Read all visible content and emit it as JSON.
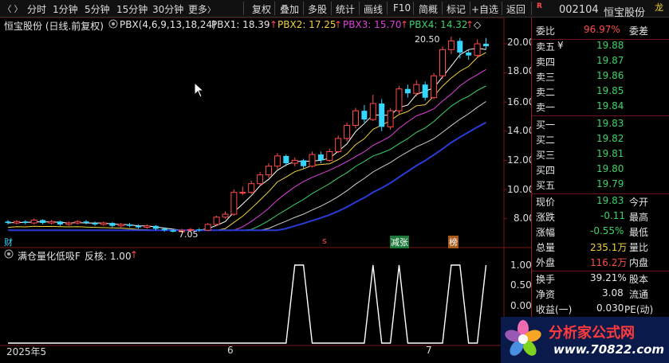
{
  "toolbar": {
    "periods": [
      "分时",
      "1分钟",
      "5分钟",
      "15分钟",
      "30分钟",
      "更多"
    ],
    "more_arrow": "〉",
    "actions": [
      "复权",
      "叠加",
      "多股",
      "统计",
      "画线",
      "F10",
      "简概",
      "标记",
      "+自选",
      "返回"
    ],
    "stock_code": "002104",
    "stock_name": "恒宝股份",
    "r_badge": "R",
    "dragon": "龙"
  },
  "chart_header": {
    "title": "恒宝股份 (日线.前复权)",
    "indicator": "PBX(4,6,9,13,18,24)",
    "pbx1": "PBX1: 18.39",
    "pbx2": "PBX2: 17.25",
    "pbx3": "PBX3: 15.70",
    "pbx4": "PBX4: 14.32",
    "up_arrow": "↑",
    "diamond": "◇"
  },
  "annotations": {
    "high_label": "20.50",
    "low_label": "7.05",
    "cai": "财",
    "s_mark": "s",
    "jian_zhang": "减张",
    "bang": "榜"
  },
  "price_axis": [
    "20.00",
    "18.00",
    "16.00",
    "14.00",
    "12.00",
    "10.00",
    "8.00"
  ],
  "sub_axis": [
    "1.00",
    "0.50",
    "0.00"
  ],
  "x_axis": [
    "2025年5",
    "6",
    "7"
  ],
  "sub_header": {
    "title": "满仓量化低吸F",
    "param": "反核: 1.00",
    "arrow": "↑"
  },
  "panel": {
    "wei_bi_label": "委比",
    "wei_bi_value": "96.97%",
    "wei_cha_label": "委差",
    "sells": [
      {
        "label": "卖五",
        "mark": "¥",
        "price": "19.88"
      },
      {
        "label": "卖四",
        "mark": "",
        "price": "19.87"
      },
      {
        "label": "卖三",
        "mark": "",
        "price": "19.86"
      },
      {
        "label": "卖二",
        "mark": "",
        "price": "19.85"
      },
      {
        "label": "卖一",
        "mark": "",
        "price": "19.84"
      }
    ],
    "buys": [
      {
        "label": "买一",
        "price": "19.83"
      },
      {
        "label": "买二",
        "price": "19.82"
      },
      {
        "label": "买三",
        "price": "19.81"
      },
      {
        "label": "买四",
        "price": "19.80"
      },
      {
        "label": "买五",
        "price": "19.79"
      }
    ],
    "quote": [
      {
        "l1": "现价",
        "v1": "19.83",
        "l2": "今开"
      },
      {
        "l1": "涨跌",
        "v1": "-0.11",
        "l2": "最高"
      },
      {
        "l1": "涨幅",
        "v1": "-0.55%",
        "l2": "最低"
      },
      {
        "l1": "总量",
        "v1": "235.1万",
        "l2": "量比"
      },
      {
        "l1": "外盘",
        "v1": "116.2万",
        "l2": "内盘"
      }
    ],
    "stats": [
      {
        "l1": "换手",
        "v1": "39.21%",
        "l2": "股本"
      },
      {
        "l1": "净资",
        "v1": "3.08",
        "l2": "流通"
      },
      {
        "l1": "收益(一)",
        "v1": "0.030",
        "l2": "PE(动)"
      }
    ]
  },
  "watermark": {
    "line1": "分析家公式网",
    "line2": "www.70822.com"
  },
  "colors": {
    "up": "#ff4b4b",
    "down": "#35d7ff",
    "pbx1": "#ffffff",
    "pbx2": "#f0d23c",
    "pbx3": "#e040e0",
    "pbx4": "#3fd16a"
  },
  "chart_data": {
    "type": "line",
    "title": "恒宝股份 (日线.前复权)",
    "ylim": [
      7.0,
      21.0
    ],
    "series": [
      {
        "name": "PBX1",
        "last": 18.39
      },
      {
        "name": "PBX2",
        "last": 17.25
      },
      {
        "name": "PBX3",
        "last": 15.7
      },
      {
        "name": "PBX4",
        "last": 14.32
      }
    ],
    "sub_series": {
      "name": "满仓量化低吸F",
      "ylim": [
        0,
        1
      ],
      "last": 1.0
    }
  }
}
